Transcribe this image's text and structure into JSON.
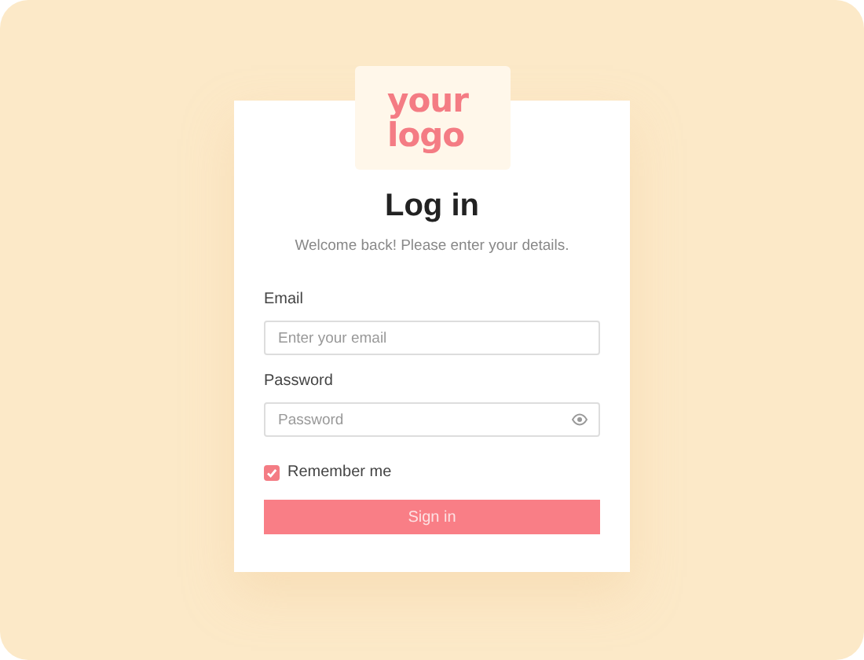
{
  "logo": {
    "text": "your\nlogo"
  },
  "title": "Log in",
  "subtitle": "Welcome back! Please enter your details.",
  "fields": [
    {
      "label": "Email",
      "placeholder": "Enter your email",
      "kind": "text"
    },
    {
      "label": "Password",
      "placeholder": "Password",
      "kind": "password"
    }
  ],
  "remember": {
    "label": "Remember me",
    "checked": true
  },
  "submit": {
    "label": "Sign in"
  }
}
